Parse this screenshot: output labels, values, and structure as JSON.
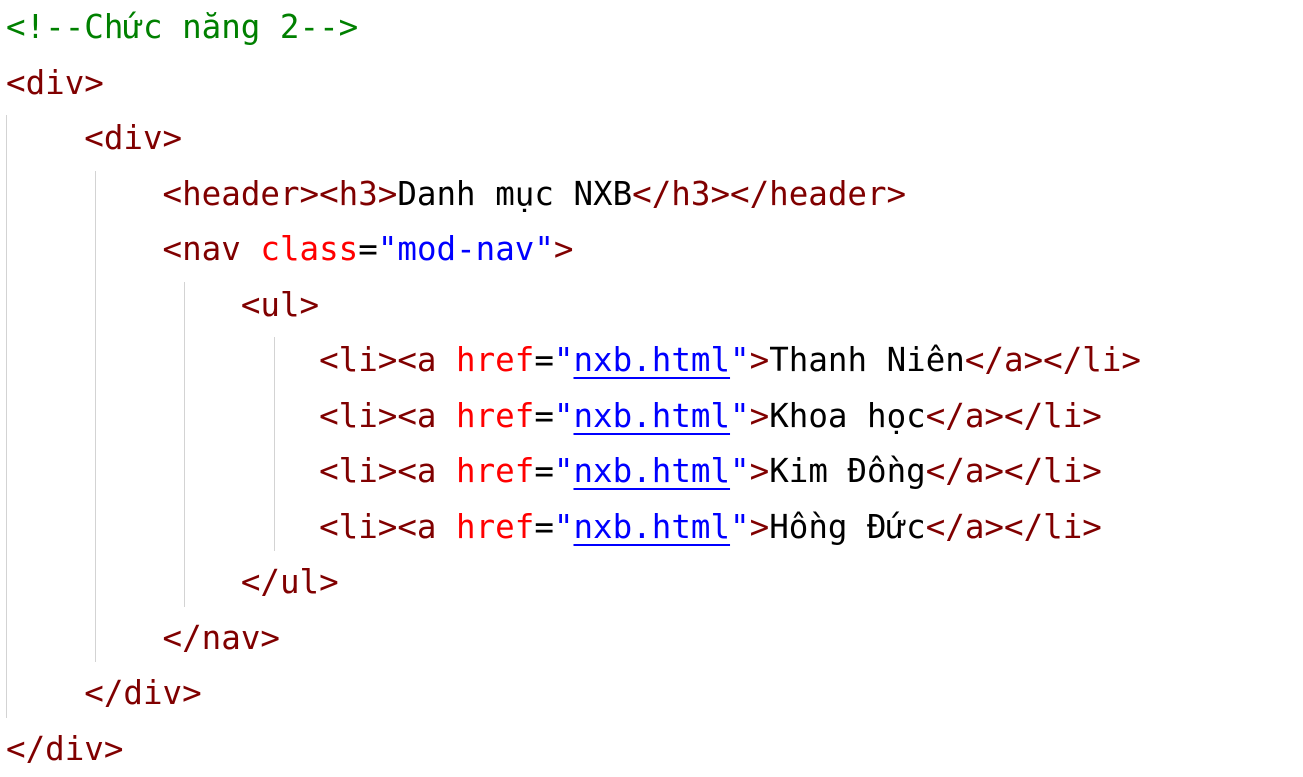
{
  "editor": {
    "lines": [
      {
        "indent": 0,
        "tokens": [
          {
            "t": "comment",
            "v": "<!--Chức năng 2-->"
          }
        ]
      },
      {
        "indent": 0,
        "tokens": [
          {
            "t": "tag",
            "v": "<div>"
          }
        ]
      },
      {
        "indent": 1,
        "tokens": [
          {
            "t": "tag",
            "v": "<div>"
          }
        ]
      },
      {
        "indent": 2,
        "tokens": [
          {
            "t": "tag",
            "v": "<header><h3>"
          },
          {
            "t": "text",
            "v": "Danh mục NXB"
          },
          {
            "t": "tag",
            "v": "</h3></header>"
          }
        ]
      },
      {
        "indent": 2,
        "tokens": [
          {
            "t": "tag",
            "v": "<nav "
          },
          {
            "t": "attr",
            "v": "class"
          },
          {
            "t": "text",
            "v": "="
          },
          {
            "t": "val",
            "v": "\"mod-nav\""
          },
          {
            "t": "tag",
            "v": ">"
          }
        ]
      },
      {
        "indent": 3,
        "tokens": [
          {
            "t": "tag",
            "v": "<ul>"
          }
        ]
      },
      {
        "indent": 4,
        "tokens": [
          {
            "t": "tag",
            "v": "<li><a "
          },
          {
            "t": "attr",
            "v": "href"
          },
          {
            "t": "text",
            "v": "="
          },
          {
            "t": "val",
            "v": "\""
          },
          {
            "t": "link",
            "v": "nxb.html"
          },
          {
            "t": "val",
            "v": "\""
          },
          {
            "t": "tag",
            "v": ">"
          },
          {
            "t": "text",
            "v": "Thanh Niên"
          },
          {
            "t": "tag",
            "v": "</a></li>"
          }
        ]
      },
      {
        "indent": 4,
        "tokens": [
          {
            "t": "tag",
            "v": "<li><a "
          },
          {
            "t": "attr",
            "v": "href"
          },
          {
            "t": "text",
            "v": "="
          },
          {
            "t": "val",
            "v": "\""
          },
          {
            "t": "link",
            "v": "nxb.html"
          },
          {
            "t": "val",
            "v": "\""
          },
          {
            "t": "tag",
            "v": ">"
          },
          {
            "t": "text",
            "v": "Khoa học"
          },
          {
            "t": "tag",
            "v": "</a></li>"
          }
        ]
      },
      {
        "indent": 4,
        "tokens": [
          {
            "t": "tag",
            "v": "<li><a "
          },
          {
            "t": "attr",
            "v": "href"
          },
          {
            "t": "text",
            "v": "="
          },
          {
            "t": "val",
            "v": "\""
          },
          {
            "t": "link",
            "v": "nxb.html"
          },
          {
            "t": "val",
            "v": "\""
          },
          {
            "t": "tag",
            "v": ">"
          },
          {
            "t": "text",
            "v": "Kim Đồng"
          },
          {
            "t": "tag",
            "v": "</a></li>"
          }
        ]
      },
      {
        "indent": 4,
        "tokens": [
          {
            "t": "tag",
            "v": "<li><a "
          },
          {
            "t": "attr",
            "v": "href"
          },
          {
            "t": "text",
            "v": "="
          },
          {
            "t": "val",
            "v": "\""
          },
          {
            "t": "link",
            "v": "nxb.html"
          },
          {
            "t": "val",
            "v": "\""
          },
          {
            "t": "tag",
            "v": ">"
          },
          {
            "t": "text",
            "v": "Hồng Đức"
          },
          {
            "t": "tag",
            "v": "</a></li>"
          }
        ]
      },
      {
        "indent": 3,
        "tokens": [
          {
            "t": "tag",
            "v": "</ul>"
          }
        ]
      },
      {
        "indent": 2,
        "tokens": [
          {
            "t": "tag",
            "v": "</nav>"
          }
        ]
      },
      {
        "indent": 1,
        "tokens": [
          {
            "t": "tag",
            "v": "</div>"
          }
        ]
      },
      {
        "indent": 0,
        "tokens": [
          {
            "t": "tag",
            "v": "</div>"
          }
        ]
      }
    ]
  },
  "colors": {
    "comment": "#008000",
    "tag": "#800000",
    "attribute": "#ff0000",
    "attribute_value": "#0000ff",
    "text": "#000000",
    "link": "#0000ff",
    "indent_guide": "#d3d3d3",
    "background": "#ffffff"
  }
}
